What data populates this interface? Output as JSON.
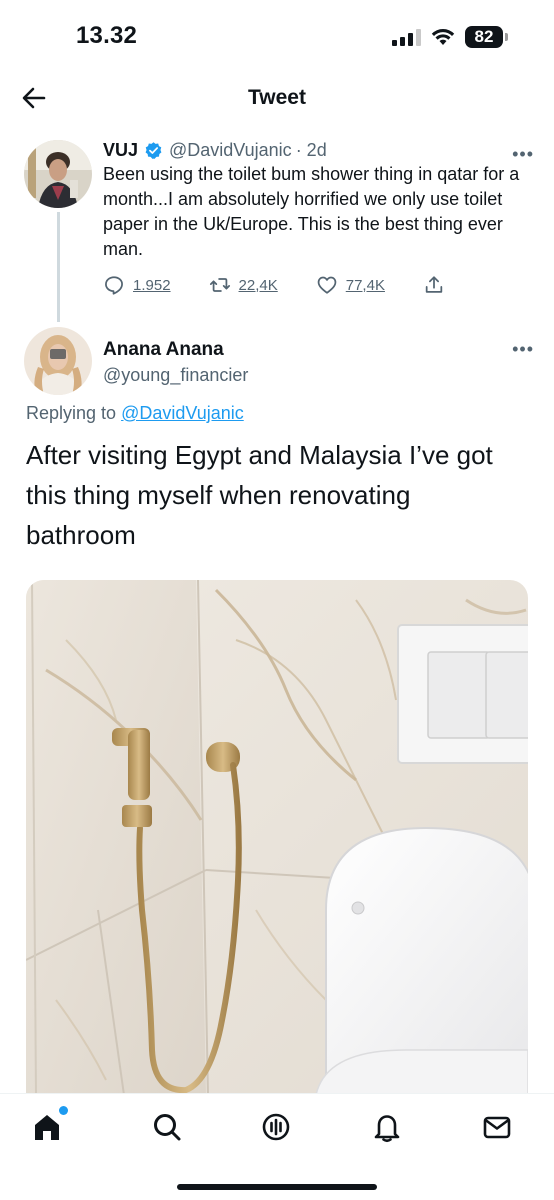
{
  "status_bar": {
    "time": "13.32",
    "battery": "82"
  },
  "header": {
    "title": "Tweet"
  },
  "original_tweet": {
    "name": "VUJ",
    "handle": "@DavidVujanic",
    "time": "· 2d",
    "text": "Been using the toilet bum shower thing in qatar for a month...I am absolutely horrified we only use toilet paper in the Uk/Europe. This is the best thing ever man.",
    "replies": "1.952",
    "retweets": "22,4K",
    "likes": "77,4K"
  },
  "reply": {
    "name": "Anana Anana",
    "handle": "@young_financier",
    "replying_prefix": "Replying to ",
    "replying_to": "@DavidVujanic",
    "text": "After visiting Egypt and Malaysia I’ve got this thing myself when renovating bathroom"
  },
  "icons": {
    "back": "back-arrow-icon",
    "verified": "verified-badge-icon",
    "more": "more-dots-icon",
    "reply": "reply-icon",
    "retweet": "retweet-icon",
    "like": "heart-icon",
    "share": "share-icon",
    "nav": [
      "home-icon",
      "search-icon",
      "spaces-icon",
      "notifications-icon",
      "messages-icon"
    ]
  },
  "colors": {
    "accent": "#1d9bf0",
    "secondary_text": "#536471",
    "text": "#0f1419"
  }
}
